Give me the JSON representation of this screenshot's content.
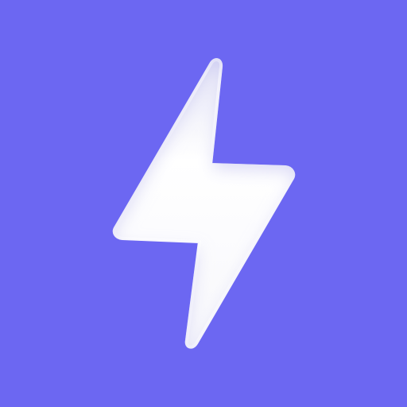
{
  "icon": {
    "name": "lightning-bolt-icon",
    "background_color": "#6C67F2",
    "glyph_color": "#FFFFFF",
    "shade_color": "#D9D9F2"
  }
}
